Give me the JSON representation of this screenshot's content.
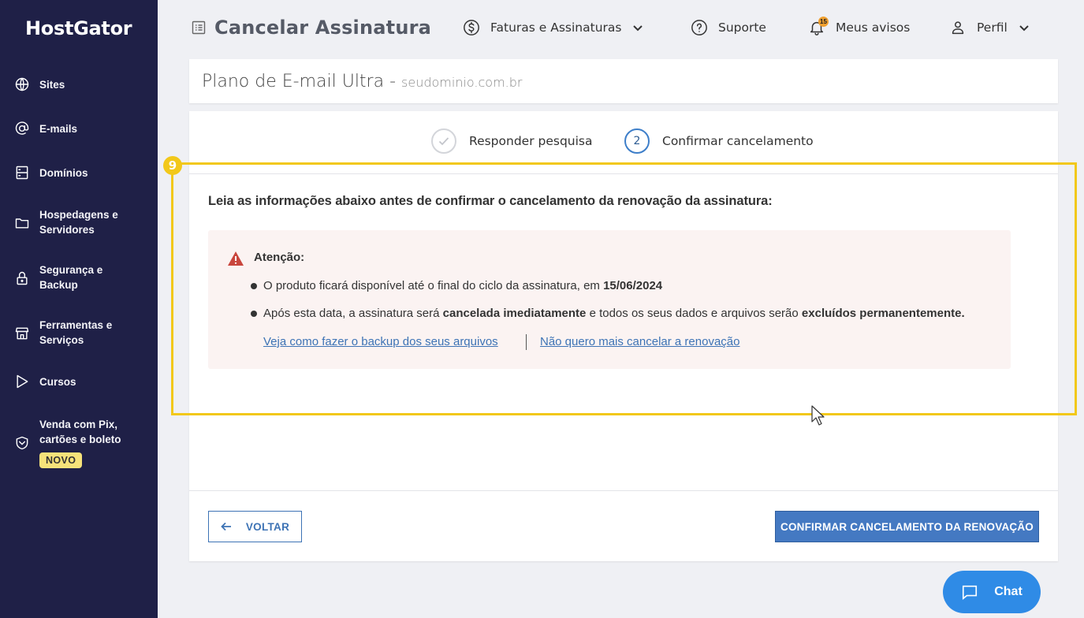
{
  "sidebar": {
    "logo": "HostGator",
    "items": [
      {
        "label": "Sites",
        "icon": "globe-icon"
      },
      {
        "label": "E-mails",
        "icon": "at-icon"
      },
      {
        "label": "Domínios",
        "icon": "server-icon"
      },
      {
        "label": "Hospedagens e\nServidores",
        "icon": "folder-icon"
      },
      {
        "label": "Segurança e\nBackup",
        "icon": "lock-icon"
      },
      {
        "label": "Ferramentas e\nServiços",
        "icon": "store-icon"
      },
      {
        "label": "Cursos",
        "icon": "play-icon"
      },
      {
        "label": "Venda com Pix,\ncartões e boleto",
        "icon": "shield-icon"
      }
    ],
    "new_badge": "NOVO"
  },
  "header": {
    "title": "Cancelar Assinatura",
    "nav": [
      {
        "label": "Faturas e Assinaturas",
        "icon": "dollar-icon"
      },
      {
        "label": "Suporte",
        "icon": "help-icon"
      },
      {
        "label": "Meus avisos",
        "icon": "bell-icon",
        "badge": "15"
      },
      {
        "label": "Perfil",
        "icon": "user-icon"
      }
    ]
  },
  "plan": {
    "name": "Plano de E-mail Ultra -",
    "domain": "seudominio.com.br"
  },
  "stepper": {
    "steps": [
      {
        "label": "Responder pesquisa",
        "status": "done"
      },
      {
        "number": "2",
        "label": "Confirmar cancelamento",
        "status": "active"
      }
    ]
  },
  "content": {
    "lead": "Leia as informações abaixo antes de confirmar o cancelamento da renovação da assinatura:",
    "alert": {
      "title": "Atenção:",
      "bullet1_text": "O produto ficará disponível até o final do ciclo da assinatura, em ",
      "bullet1_date": "15/06/2024",
      "bullet2_a": "Após esta data, a assinatura será ",
      "bullet2_b": "cancelada imediatamente",
      "bullet2_c": " e todos os seus dados e arquivos serão ",
      "bullet2_d": "excluídos permanentemente.",
      "link_backup": "Veja como fazer o backup dos seus arquivos",
      "link_keep": "Não quero mais cancelar a renovação"
    }
  },
  "footer": {
    "back": "VOLTAR",
    "confirm": "CONFIRMAR CANCELAMENTO DA RENOVAÇÃO"
  },
  "highlight_number": "9",
  "chat": {
    "label": "Chat"
  },
  "colors": {
    "sidebar_bg": "#1f2047",
    "primary": "#4479c2",
    "highlight": "#f2c81a",
    "alert_bg": "#fbf3f2",
    "chat": "#2f8be6"
  }
}
